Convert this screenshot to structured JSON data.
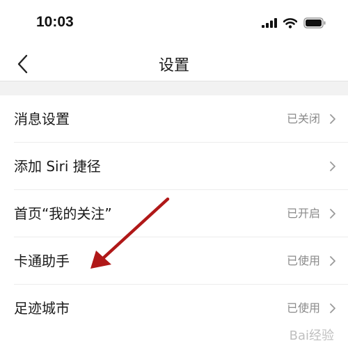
{
  "status_bar": {
    "time": "10:03",
    "icons": [
      "signal-icon",
      "wifi-icon",
      "battery-icon"
    ]
  },
  "nav": {
    "title": "设置",
    "back_icon": "chevron-left-icon"
  },
  "settings": [
    {
      "label": "消息设置",
      "value": "已关闭"
    },
    {
      "label": "添加 Siri 捷径",
      "value": ""
    },
    {
      "label": "首页“我的关注”",
      "value": "已开启"
    },
    {
      "label": "卡通助手",
      "value": "已使用"
    },
    {
      "label": "足迹城市",
      "value": "已使用"
    }
  ],
  "annotation": {
    "color": "#b01818",
    "icon": "red-arrow-annotation"
  },
  "watermark": {
    "text": "Bai经验"
  },
  "colors": {
    "value_text": "#8a8a8a",
    "divider": "#ececec",
    "section_gap": "#f2f2f2"
  }
}
